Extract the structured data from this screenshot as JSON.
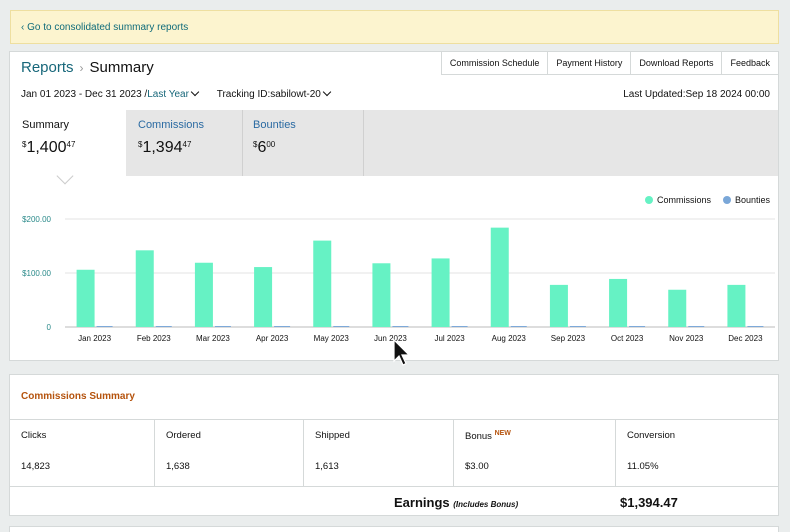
{
  "banner": {
    "text": "‹ Go to consolidated summary reports"
  },
  "breadcrumb": {
    "parent": "Reports",
    "separator": "›",
    "current": "Summary"
  },
  "top_buttons": [
    "Commission Schedule",
    "Payment History",
    "Download Reports",
    "Feedback"
  ],
  "filters": {
    "date_range": "Jan 01 2023 - Dec 31 2023 /",
    "period": "Last Year",
    "tracking": "Tracking ID:sabilowt-20"
  },
  "last_updated": "Last Updated:Sep 18 2024 00:00",
  "tabs": [
    {
      "label": "Summary",
      "currency": "$",
      "whole": "1,400",
      "cents": "47",
      "active": true
    },
    {
      "label": "Commissions",
      "currency": "$",
      "whole": "1,394",
      "cents": "47",
      "active": false
    },
    {
      "label": "Bounties",
      "currency": "$",
      "whole": "6",
      "cents": "00",
      "active": false
    }
  ],
  "chart_data": {
    "type": "bar",
    "categories": [
      "Jan 2023",
      "Feb 2023",
      "Mar 2023",
      "Apr 2023",
      "May 2023",
      "Jun 2023",
      "Jul 2023",
      "Aug 2023",
      "Sep 2023",
      "Oct 2023",
      "Nov 2023",
      "Dec 2023"
    ],
    "series": [
      {
        "name": "Commissions",
        "color": "#66f2c4",
        "values": [
          106,
          142,
          119,
          111,
          160,
          118,
          127,
          184,
          78,
          89,
          69,
          78
        ]
      },
      {
        "name": "Bounties",
        "color": "#7aa7d8",
        "values": [
          3,
          3,
          3,
          3,
          3,
          3,
          3,
          3,
          3,
          3,
          3,
          3
        ]
      }
    ],
    "ytick_labels": [
      "0",
      "$100.00",
      "$200.00"
    ],
    "yticks": [
      0,
      100,
      200
    ],
    "ylim": [
      0,
      200
    ],
    "grid": true,
    "legend": "top-right"
  },
  "commissions_summary": {
    "title": "Commissions Summary",
    "cells": [
      {
        "label": "Clicks",
        "badge": "",
        "value": "14,823"
      },
      {
        "label": "Ordered",
        "badge": "",
        "value": "1,638"
      },
      {
        "label": "Shipped",
        "badge": "",
        "value": "1,613"
      },
      {
        "label": "Bonus",
        "badge": "NEW",
        "value": "$3.00"
      },
      {
        "label": "Conversion",
        "badge": "",
        "value": "11.05%"
      }
    ],
    "earnings_label": "Earnings",
    "earnings_note": "(Includes Bonus)",
    "earnings_value": "$1,394.47"
  },
  "colors": {
    "accent_link": "#17677a",
    "commissions": "#66f2c4",
    "bounties": "#7aa7d8",
    "section_title": "#b5530d"
  }
}
